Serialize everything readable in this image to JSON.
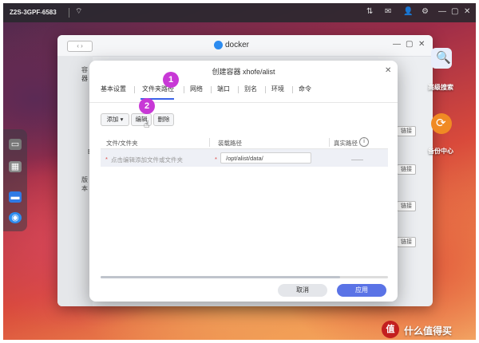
{
  "topbar": {
    "device_name": "Z2S-3GPF-6583"
  },
  "bg_window": {
    "title": "docker",
    "sidebar": {
      "item_top": "容器",
      "item_mid": "E",
      "item_bottom": "版本"
    },
    "row_button": "链接"
  },
  "desktop": {
    "icons": [
      {
        "label": "高级搜索",
        "icon": "search-icon",
        "color": "#5b8ad6"
      },
      {
        "label": "备份中心",
        "icon": "backup-icon",
        "color": "#f08a24"
      }
    ]
  },
  "dialog": {
    "title": "创建容器 xhofe/alist",
    "tabs": [
      "基本设置",
      "文件夹路径",
      "网络",
      "端口",
      "别名",
      "环境",
      "命令"
    ],
    "active_tab": "文件夹路径",
    "toolbar": {
      "add": "添加",
      "edit": "编辑",
      "delete": "删除"
    },
    "table": {
      "headers": [
        "文件/文件夹",
        "装载路径",
        "真实路径"
      ],
      "row": {
        "file_placeholder": "点击编辑添加文件或文件夹",
        "mount_path": "/opt/alist/data/",
        "real_path": "——"
      }
    },
    "buttons": {
      "cancel": "取消",
      "apply": "应用"
    }
  },
  "annotations": {
    "step1": "1",
    "step2": "2"
  },
  "watermark": {
    "logo_text": "值",
    "text": "什么值得买"
  },
  "colors": {
    "accent": "#3a63e8",
    "apply": "#5a73e6",
    "badge": "#c838d6",
    "required": "#e0463f"
  }
}
